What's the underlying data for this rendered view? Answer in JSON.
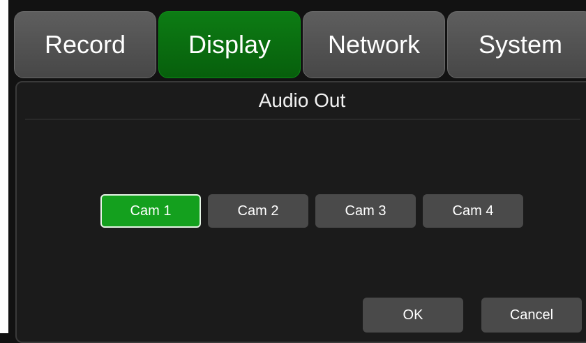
{
  "tabs": [
    {
      "label": "Record",
      "active": false
    },
    {
      "label": "Display",
      "active": true
    },
    {
      "label": "Network",
      "active": false
    },
    {
      "label": "System",
      "active": false
    }
  ],
  "panel": {
    "title": "Audio Out",
    "cameras": [
      {
        "label": "Cam 1",
        "selected": true
      },
      {
        "label": "Cam 2",
        "selected": false
      },
      {
        "label": "Cam 3",
        "selected": false
      },
      {
        "label": "Cam 4",
        "selected": false
      }
    ],
    "ok_label": "OK",
    "cancel_label": "Cancel"
  },
  "colors": {
    "active_tab": "#0d7c14",
    "selected_button": "#14a01e",
    "button": "#4a4a4a",
    "background": "#121212"
  }
}
